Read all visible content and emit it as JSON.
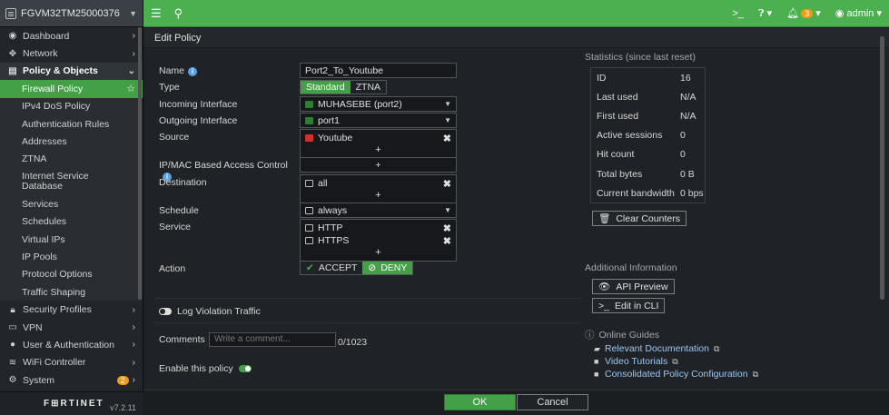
{
  "device": {
    "name": "FGVM32TM25000376"
  },
  "sidebar": {
    "items": [
      {
        "label": "Dashboard"
      },
      {
        "label": "Network"
      },
      {
        "label": "Policy & Objects"
      },
      {
        "label": "Firewall Policy"
      },
      {
        "label": "IPv4 DoS Policy"
      },
      {
        "label": "Authentication Rules"
      },
      {
        "label": "Addresses"
      },
      {
        "label": "ZTNA"
      },
      {
        "label": "Internet Service Database"
      },
      {
        "label": "Services"
      },
      {
        "label": "Schedules"
      },
      {
        "label": "Virtual IPs"
      },
      {
        "label": "IP Pools"
      },
      {
        "label": "Protocol Options"
      },
      {
        "label": "Traffic Shaping"
      },
      {
        "label": "Security Profiles"
      },
      {
        "label": "VPN"
      },
      {
        "label": "User & Authentication"
      },
      {
        "label": "WiFi Controller"
      },
      {
        "label": "System",
        "badge": "2"
      }
    ],
    "logo": "F⊞RTINET",
    "version": "v7.2.11"
  },
  "topbar": {
    "alerts": "3",
    "user": "admin"
  },
  "page": {
    "title": "Edit Policy"
  },
  "form": {
    "name_label": "Name",
    "name_value": "Port2_To_Youtube",
    "type_label": "Type",
    "type_options": [
      "Standard",
      "ZTNA"
    ],
    "incoming_label": "Incoming Interface",
    "incoming_value": "MUHASEBE (port2)",
    "outgoing_label": "Outgoing Interface",
    "outgoing_value": "port1",
    "source_label": "Source",
    "source_value": "Youtube",
    "ipmac_label": "IP/MAC Based Access Control",
    "destination_label": "Destination",
    "destination_value": "all",
    "schedule_label": "Schedule",
    "schedule_value": "always",
    "service_label": "Service",
    "service_values": [
      "HTTP",
      "HTTPS"
    ],
    "action_label": "Action",
    "action_accept": "ACCEPT",
    "action_deny": "DENY",
    "log_violation": "Log Violation Traffic",
    "comments_label": "Comments",
    "comments_placeholder": "Write a comment...",
    "comments_count": "0/1023",
    "enable_label": "Enable this policy"
  },
  "stats": {
    "title": "Statistics (since last reset)",
    "rows": [
      {
        "k": "ID",
        "v": "16"
      },
      {
        "k": "Last used",
        "v": "N/A"
      },
      {
        "k": "First used",
        "v": "N/A"
      },
      {
        "k": "Active sessions",
        "v": "0"
      },
      {
        "k": "Hit count",
        "v": "0"
      },
      {
        "k": "Total bytes",
        "v": "0 B"
      },
      {
        "k": "Current bandwidth",
        "v": "0 bps"
      }
    ],
    "clear_button": "Clear Counters"
  },
  "additional": {
    "title": "Additional Information",
    "api_preview": "API Preview",
    "edit_cli": "Edit in CLI",
    "online_guides": "Online Guides",
    "links": [
      "Relevant Documentation",
      "Video Tutorials",
      "Consolidated Policy Configuration"
    ]
  },
  "footer": {
    "ok": "OK",
    "cancel": "Cancel"
  }
}
